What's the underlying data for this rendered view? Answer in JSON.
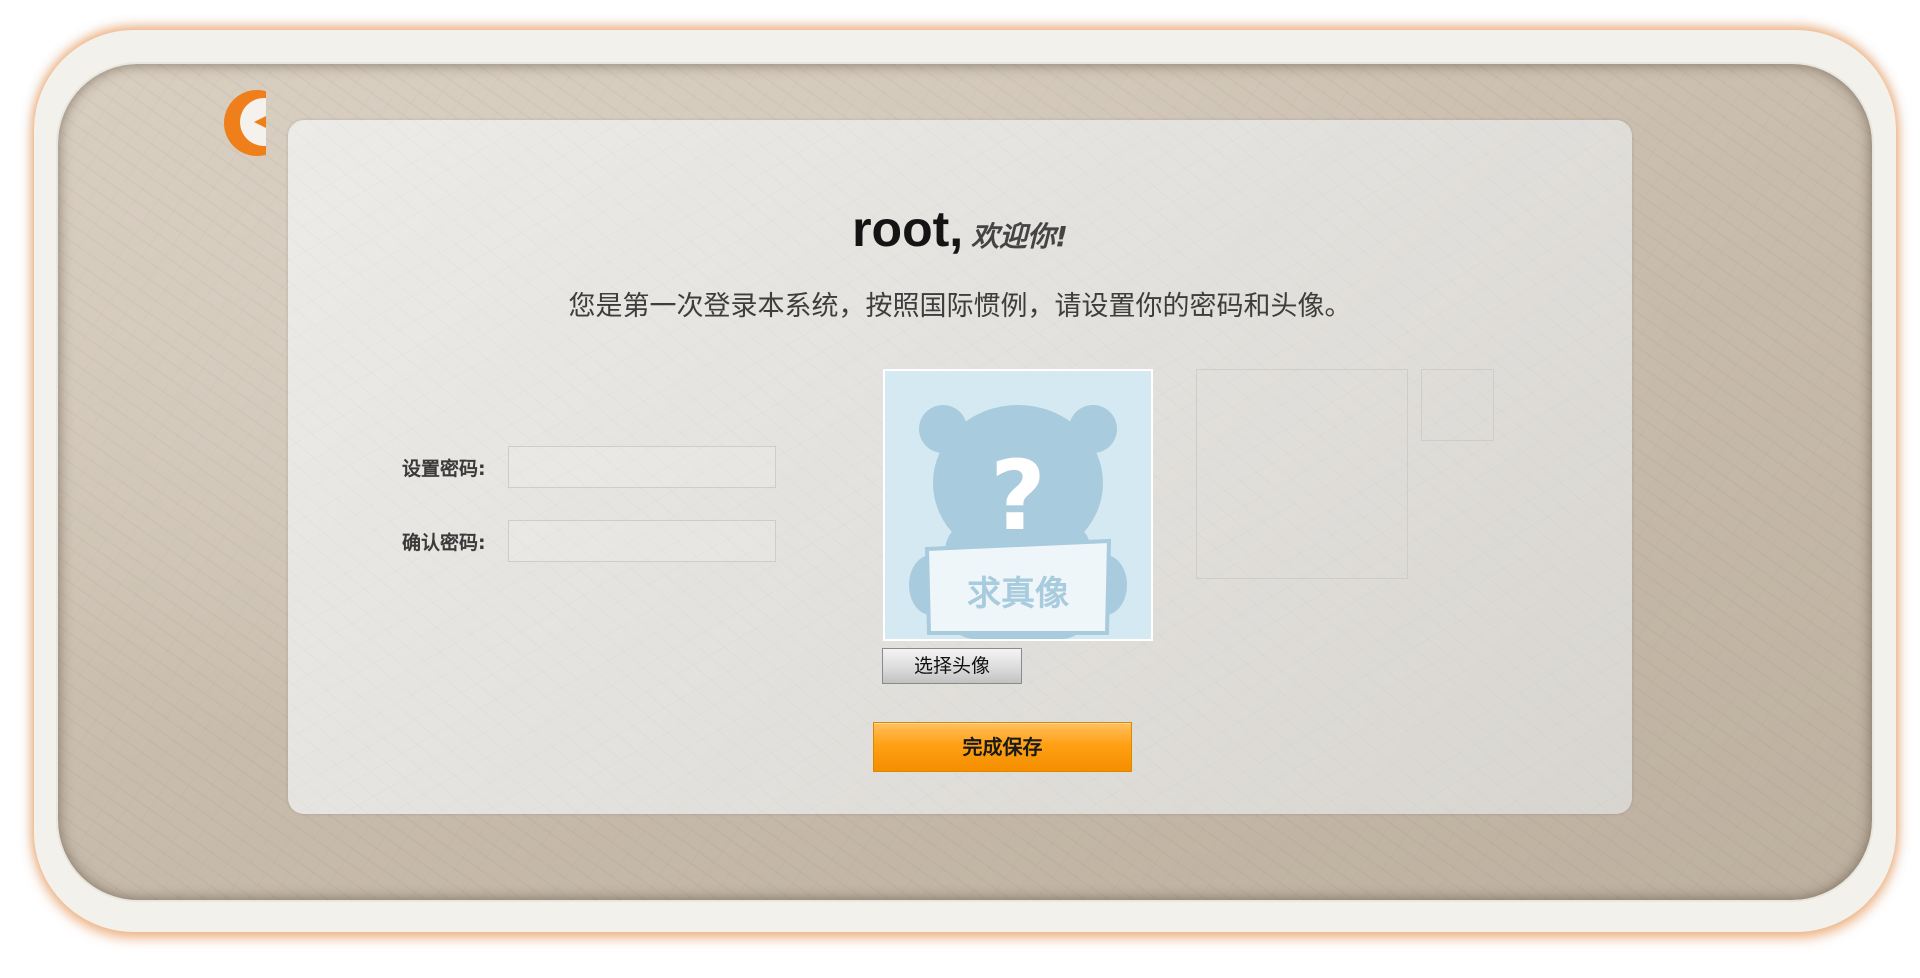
{
  "header": {
    "username": "root,",
    "welcome": "欢迎你!"
  },
  "subtitle": "您是第一次登录本系统，按照国际惯例，请设置你的密码和头像。",
  "form": {
    "password_label": "设置密码:",
    "confirm_label": "确认密码:",
    "password_value": "",
    "confirm_value": ""
  },
  "avatar": {
    "placeholder_text": "求真像",
    "choose_label": "选择头像"
  },
  "actions": {
    "save_label": "完成保存"
  },
  "colors": {
    "accent": "#ffa114",
    "logo": "#ef7f1a",
    "avatar_bg": "#d4e9f2",
    "avatar_figure": "#a8cbdd"
  },
  "icons": {
    "logo": "orange-crescent-logo-icon",
    "avatar": "bear-question-mark-icon"
  }
}
